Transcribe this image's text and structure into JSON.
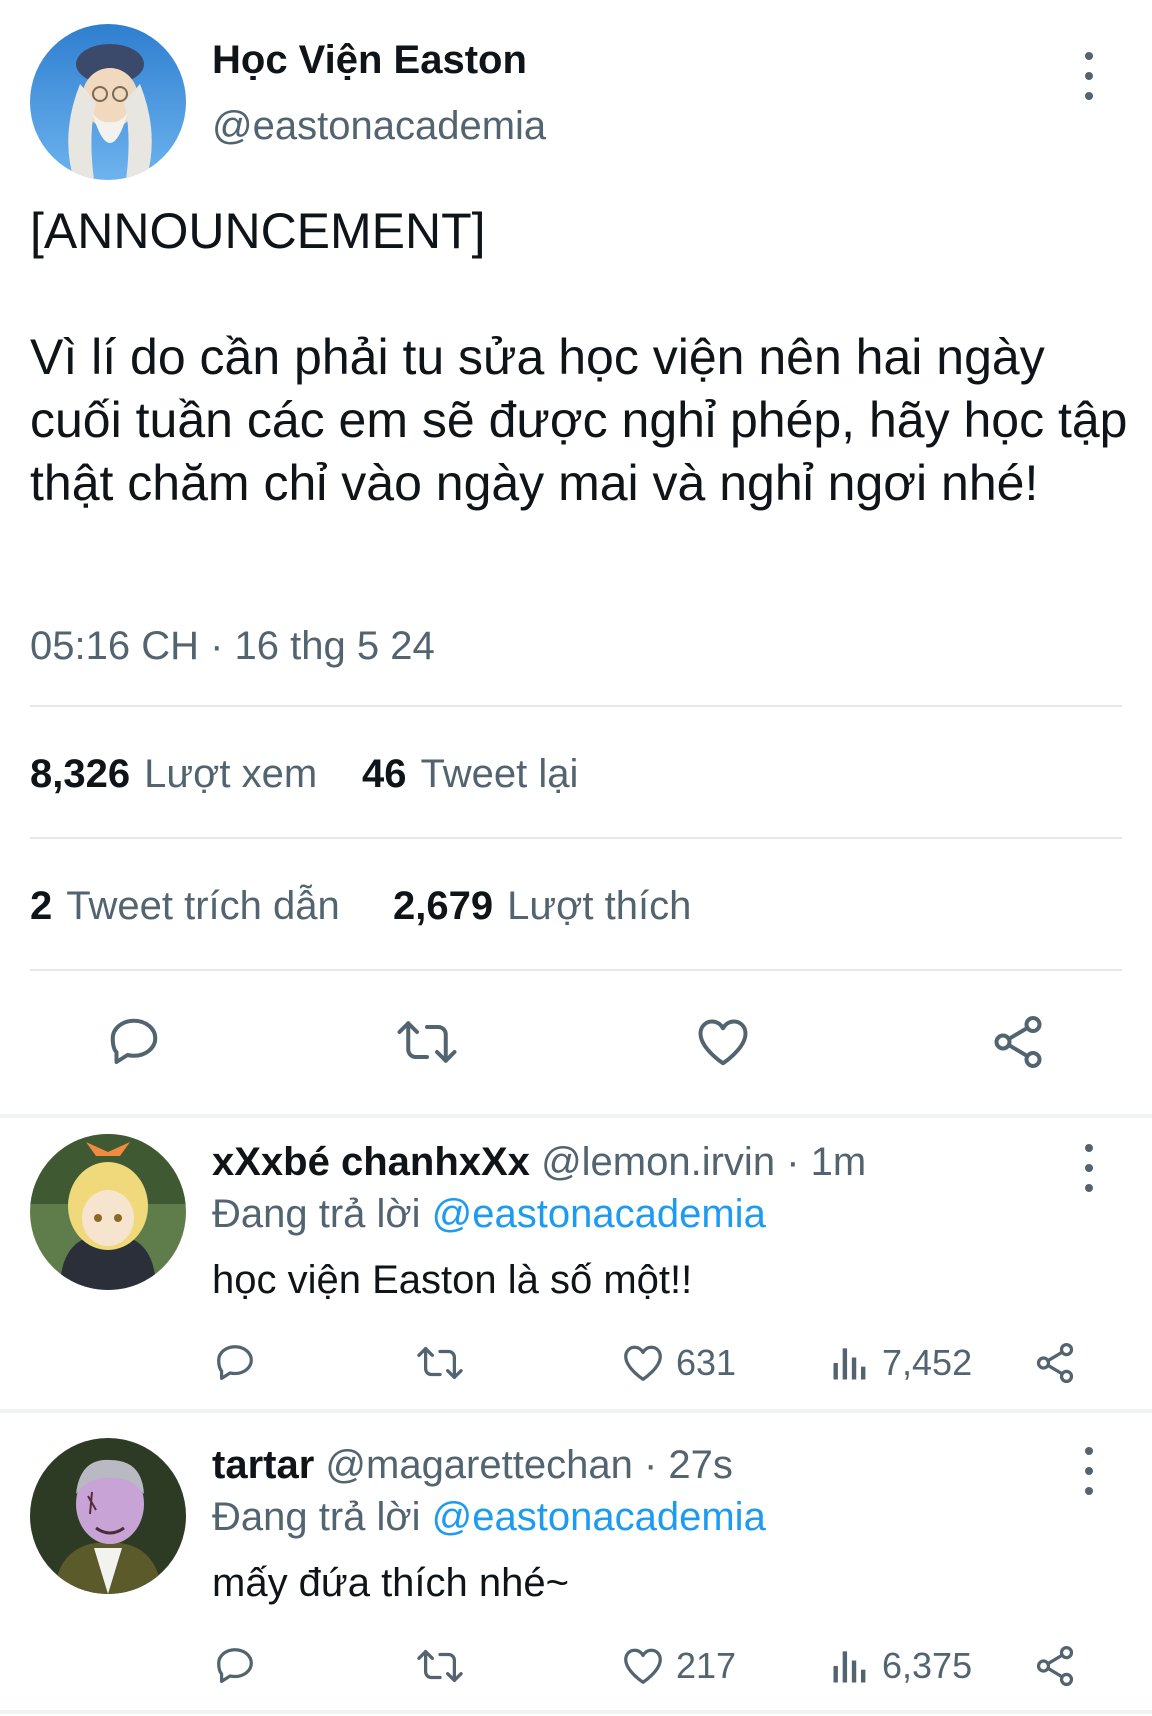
{
  "tweet": {
    "author_name": "Học Viện Easton",
    "author_handle": "@eastonacademia",
    "text": "[ANNOUNCEMENT]\n\nVì lí do cần phải tu sửa học viện nên hai ngày cuối tuần các em sẽ được nghỉ phép, hãy học tập thật chăm chỉ vào ngày mai và nghỉ ngơi nhé!",
    "timestamp": "05:16 CH · 16 thg 5 24",
    "stats": {
      "views_count": "8,326",
      "views_label": "Lượt xem",
      "retweets_count": "46",
      "retweets_label": "Tweet lại",
      "quotes_count": "2",
      "quotes_label": "Tweet trích dẫn",
      "likes_count": "2,679",
      "likes_label": "Lượt thích"
    },
    "actions": [
      "reply-icon",
      "retweet-icon",
      "like-icon",
      "share-icon"
    ]
  },
  "replies": [
    {
      "name": "xXxbé chanhxXx",
      "handle": "@lemon.irvin",
      "time": "· 1m",
      "replying_label": "Đang trả lời",
      "replying_to": "@eastonacademia",
      "text": "học viện Easton là số một!!",
      "likes": "631",
      "views": "7,452"
    },
    {
      "name": "tartar",
      "handle": "@magarettechan",
      "time": "· 27s",
      "replying_label": "Đang trả lời",
      "replying_to": "@eastonacademia",
      "text": "mấy đứa thích nhé~",
      "likes": "217",
      "views": "6,375"
    }
  ],
  "colors": {
    "text_primary": "#0f1419",
    "text_secondary": "#536471",
    "accent": "#1d9bf0",
    "divider": "#e4e8eb"
  }
}
